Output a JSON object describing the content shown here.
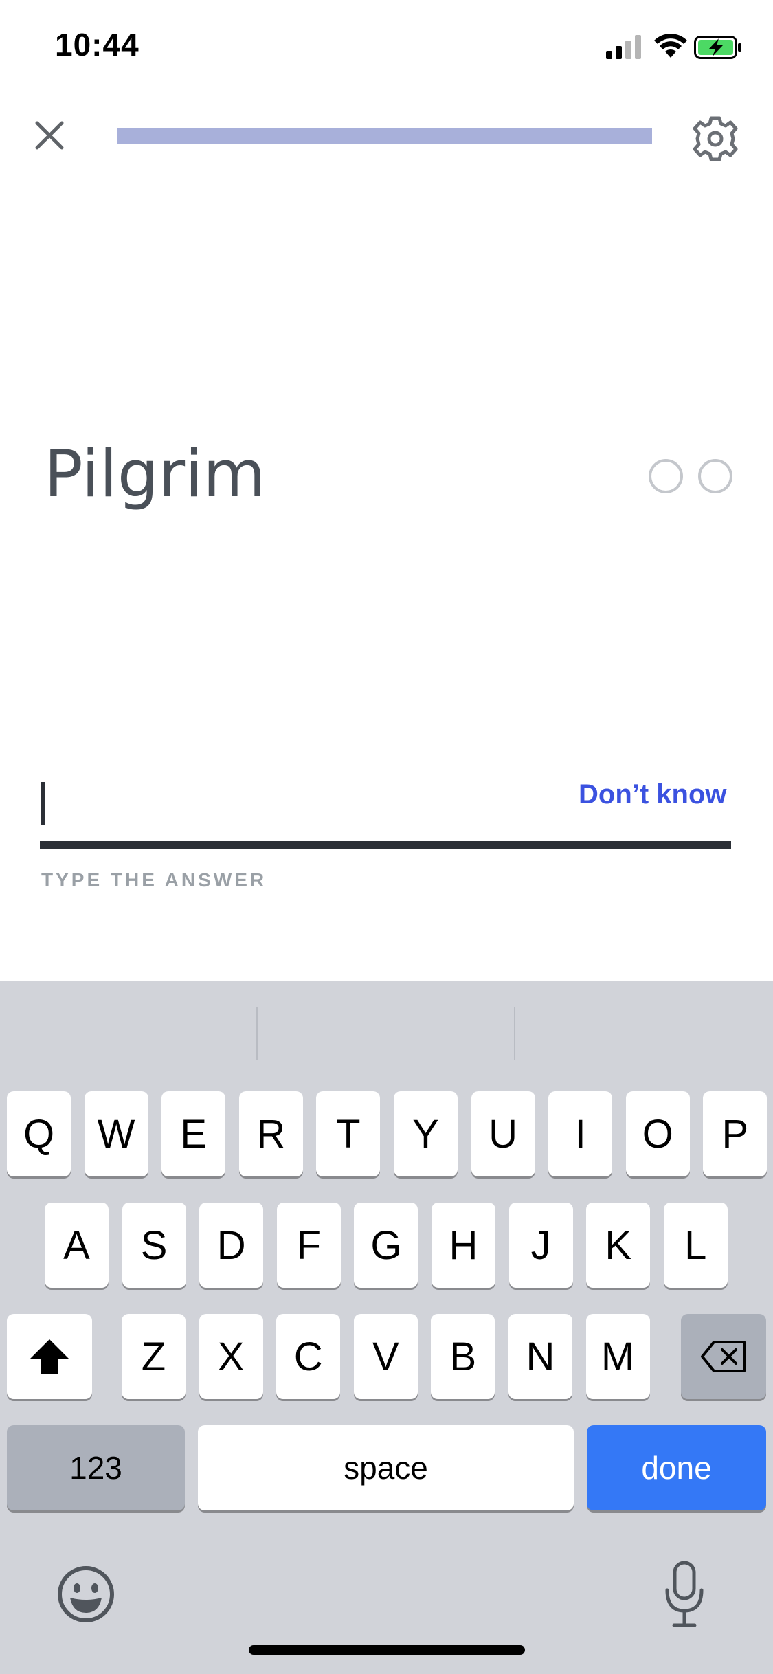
{
  "status_bar": {
    "time": "10:44"
  },
  "header": {
    "progress_fraction": 1.0
  },
  "card": {
    "word": "Pilgrim",
    "attempt_dots": 2
  },
  "answer": {
    "value": "",
    "dont_know_label": "Don’t know",
    "hint": "TYPE THE ANSWER"
  },
  "keyboard": {
    "row1": [
      "Q",
      "W",
      "E",
      "R",
      "T",
      "Y",
      "U",
      "I",
      "O",
      "P"
    ],
    "row2": [
      "A",
      "S",
      "D",
      "F",
      "G",
      "H",
      "J",
      "K",
      "L"
    ],
    "row3": [
      "Z",
      "X",
      "C",
      "V",
      "B",
      "N",
      "M"
    ],
    "numbers_label": "123",
    "space_label": "space",
    "done_label": "done"
  },
  "colors": {
    "progress": "#a8b0da",
    "accent": "#3b52e0",
    "done_key": "#3478f6",
    "keyboard_bg": "#d1d3d9"
  }
}
